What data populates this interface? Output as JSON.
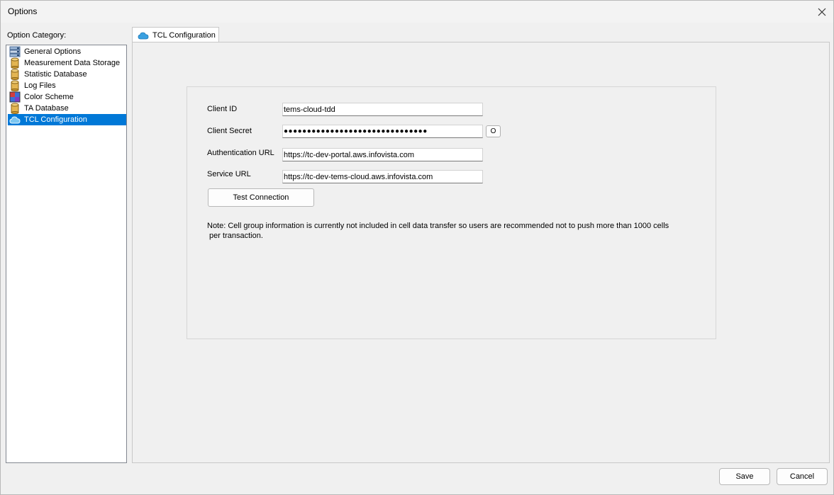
{
  "window": {
    "title": "Options"
  },
  "sidebar": {
    "label": "Option Category:",
    "items": [
      {
        "label": "General Options",
        "icon": "settings-list-icon"
      },
      {
        "label": "Measurement Data Storage",
        "icon": "database-icon"
      },
      {
        "label": "Statistic Database",
        "icon": "database-icon"
      },
      {
        "label": "Log Files",
        "icon": "database-icon"
      },
      {
        "label": "Color Scheme",
        "icon": "color-palette-icon"
      },
      {
        "label": "TA Database",
        "icon": "database-icon"
      },
      {
        "label": "TCL Configuration",
        "icon": "cloud-icon",
        "selected": true
      }
    ]
  },
  "tab": {
    "label": "TCL Configuration",
    "icon": "cloud-icon"
  },
  "form": {
    "client_id": {
      "label": "Client ID",
      "value": "tems-cloud-tdd"
    },
    "client_secret": {
      "label": "Client Secret",
      "value": "●●●●●●●●●●●●●●●●●●●●●●●●●●●●●●●"
    },
    "reveal_label": "O",
    "auth_url": {
      "label": "Authentication URL",
      "value": "https://tc-dev-portal.aws.infovista.com"
    },
    "service_url": {
      "label": "Service URL",
      "value": "https://tc-dev-tems-cloud.aws.infovista.com"
    },
    "test_button": "Test Connection",
    "note_line1": "Note: Cell group information is currently not included in cell data transfer so users are recommended not to push more than 1000 cells",
    "note_line2": " per transaction."
  },
  "footer": {
    "save": "Save",
    "cancel": "Cancel"
  },
  "colors": {
    "selection": "#0078d7",
    "cloud": "#3aa0e0",
    "db": "#d9a441"
  }
}
